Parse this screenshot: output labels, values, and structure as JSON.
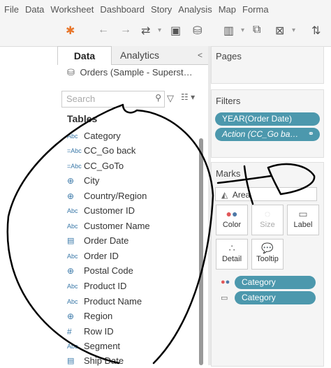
{
  "menu": [
    "File",
    "Data",
    "Worksheet",
    "Dashboard",
    "Story",
    "Analysis",
    "Map",
    "Forma"
  ],
  "tabs": {
    "data": "Data",
    "analytics": "Analytics"
  },
  "datasource": "Orders (Sample - Superst…",
  "search": {
    "placeholder": "Search"
  },
  "tables_header": "Tables",
  "fields": [
    {
      "type": "Abc",
      "label": "Category"
    },
    {
      "type": "=Abc",
      "label": "CC_Go back"
    },
    {
      "type": "=Abc",
      "label": "CC_GoTo"
    },
    {
      "type": "globe",
      "label": "City"
    },
    {
      "type": "globe",
      "label": "Country/Region"
    },
    {
      "type": "Abc",
      "label": "Customer ID"
    },
    {
      "type": "Abc",
      "label": "Customer Name"
    },
    {
      "type": "date",
      "label": "Order Date"
    },
    {
      "type": "Abc",
      "label": "Order ID"
    },
    {
      "type": "globe",
      "label": "Postal Code"
    },
    {
      "type": "Abc",
      "label": "Product ID"
    },
    {
      "type": "Abc",
      "label": "Product Name"
    },
    {
      "type": "globe",
      "label": "Region"
    },
    {
      "type": "#",
      "label": "Row ID"
    },
    {
      "type": "Abc",
      "label": "Segment"
    },
    {
      "type": "date",
      "label": "Ship Date"
    }
  ],
  "pages": {
    "title": "Pages"
  },
  "filters": {
    "title": "Filters",
    "items": [
      "YEAR(Order Date)",
      "Action (CC_Go ba…"
    ]
  },
  "marks": {
    "title": "Marks",
    "type": "Area",
    "buttons": [
      "Color",
      "Size",
      "Label",
      "Detail",
      "Tooltip"
    ],
    "pills": [
      "Category",
      "Category"
    ]
  },
  "colors": {
    "pill": "#4c98ad",
    "annotation": "#000000"
  }
}
